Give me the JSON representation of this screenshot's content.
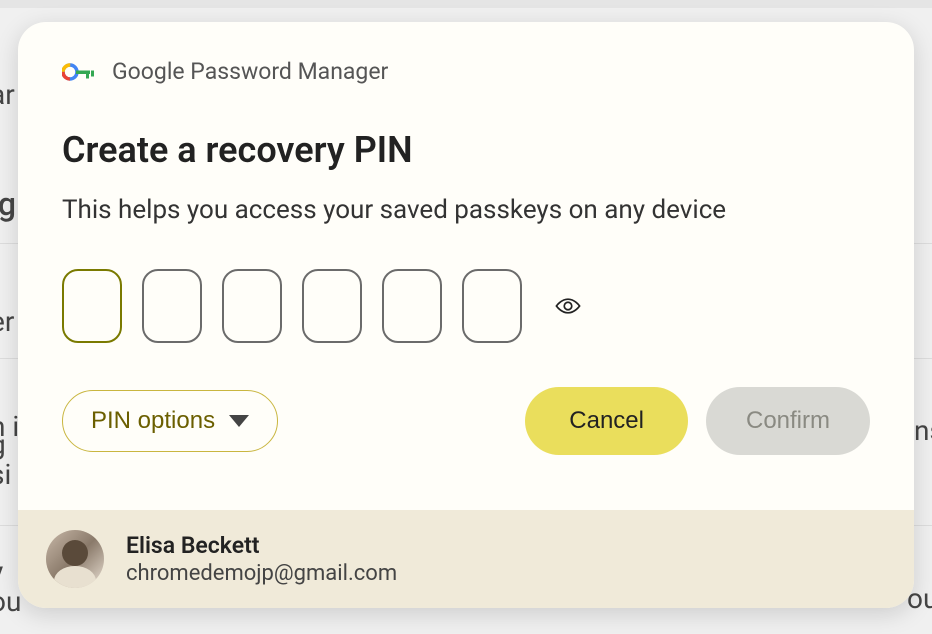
{
  "header": {
    "app_name": "Google Password Manager"
  },
  "dialog": {
    "title": "Create a recovery PIN",
    "subtitle": "This helps you access your saved passkeys on any device",
    "pin_length": 6,
    "buttons": {
      "pin_options_label": "PIN options",
      "cancel_label": "Cancel",
      "confirm_label": "Confirm"
    }
  },
  "user": {
    "name": "Elisa Beckett",
    "email": "chromedemojp@gmail.com"
  },
  "bg_fragments": {
    "t1": "ar",
    "t2": "ng",
    "t3": "er",
    "t4": "n i",
    "t5": "g",
    "t6": "ns",
    "t7": "y",
    "t8": "ou",
    "t9": "ou",
    "t13": "si"
  }
}
